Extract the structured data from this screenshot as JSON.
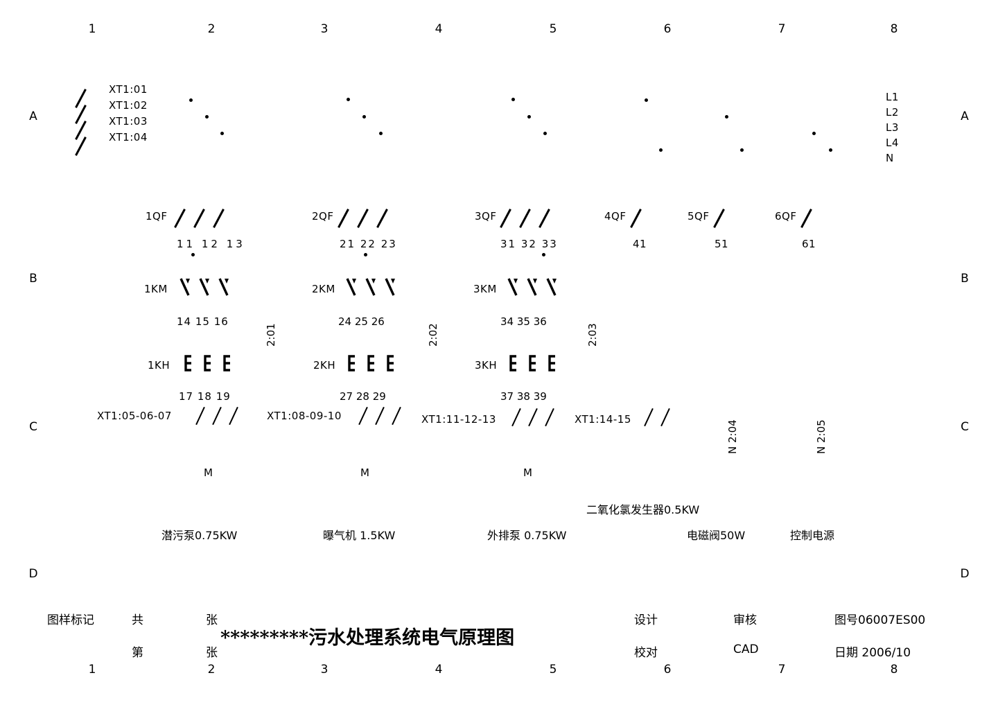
{
  "sheet": {
    "columns": [
      "1",
      "2",
      "3",
      "4",
      "5",
      "6",
      "7",
      "8"
    ],
    "rows": [
      "A",
      "B",
      "C",
      "D"
    ]
  },
  "supply": {
    "incoming_terminals": [
      "XT1:01",
      "XT1:02",
      "XT1:03",
      "XT1:04"
    ],
    "phase_labels": [
      "L1",
      "L2",
      "L3",
      "L4",
      "N"
    ]
  },
  "breakers": [
    {
      "tag": "1QF",
      "poles": 3,
      "terminals": "11 12 13"
    },
    {
      "tag": "2QF",
      "poles": 3,
      "terminals": "21 22 23"
    },
    {
      "tag": "3QF",
      "poles": 3,
      "terminals": "31 32 33"
    },
    {
      "tag": "4QF",
      "poles": 1,
      "terminals": "41"
    },
    {
      "tag": "5QF",
      "poles": 1,
      "terminals": "51"
    },
    {
      "tag": "6QF",
      "poles": 1,
      "terminals": "61"
    }
  ],
  "contactors": [
    {
      "tag": "1KM",
      "terminals": "14 15 16"
    },
    {
      "tag": "2KM",
      "terminals": "24 25 26"
    },
    {
      "tag": "3KM",
      "terminals": "34 35 36"
    }
  ],
  "thermal_relays": [
    {
      "tag": "1KH",
      "terminals": "17 18 19"
    },
    {
      "tag": "2KH",
      "terminals": "27 28 29"
    },
    {
      "tag": "3KH",
      "terminals": "37 38 39"
    }
  ],
  "outgoing_terminals": [
    "XT1:05-06-07",
    "XT1:08-09-10",
    "XT1:11-12-13",
    "XT1:14-15"
  ],
  "cross_references": [
    {
      "label": "2:01"
    },
    {
      "label": "2:02"
    },
    {
      "label": "2:03"
    },
    {
      "label": "N 2:04"
    },
    {
      "label": "N 2:05"
    }
  ],
  "motors": [
    "M",
    "M",
    "M"
  ],
  "loads": [
    {
      "name": "潜污泵0.75KW"
    },
    {
      "name": "曝气机 1.5KW"
    },
    {
      "name": "外排泵 0.75KW"
    },
    {
      "name": "二氧化氯发生器0.5KW"
    },
    {
      "name": "电磁阀50W"
    },
    {
      "name": "控制电源"
    }
  ],
  "title_block": {
    "mark_label": "图样标记",
    "total_label": "共",
    "total_unit": "张",
    "sheet_label": "第",
    "sheet_unit": "张",
    "drawing_title": "*********污水处理系统电气原理图",
    "design_label": "设计",
    "proof_label": "校对",
    "review_label": "审核",
    "review_value": "CAD",
    "dwg_no": "图号06007ES00",
    "date": "日期 2006/10"
  }
}
